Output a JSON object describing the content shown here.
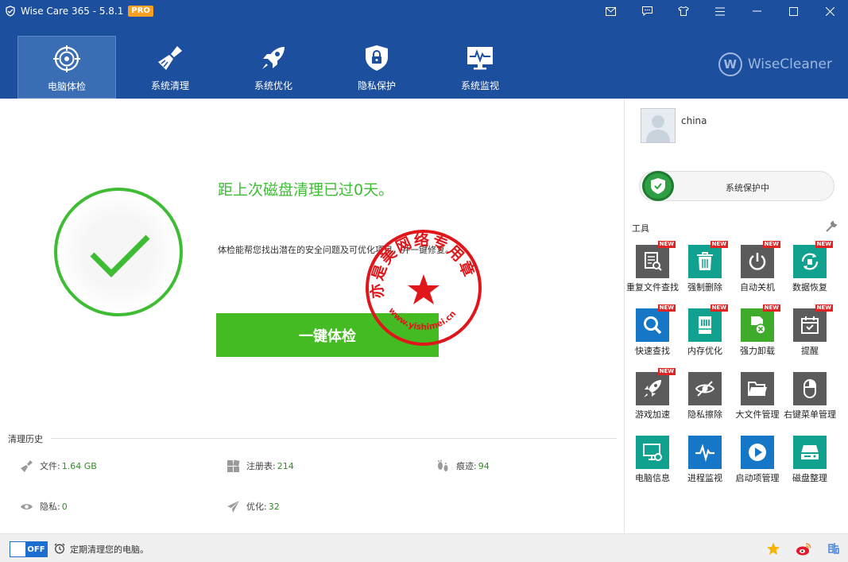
{
  "app": {
    "title": "Wise Care 365 - 5.8.1",
    "badge": "PRO",
    "brand": "WiseCleaner"
  },
  "nav": [
    {
      "label": "电脑体检",
      "icon": "target-icon"
    },
    {
      "label": "系统清理",
      "icon": "broom-icon"
    },
    {
      "label": "系统优化",
      "icon": "rocket-icon"
    },
    {
      "label": "隐私保护",
      "icon": "lock-shield-icon"
    },
    {
      "label": "系统监视",
      "icon": "monitor-icon"
    }
  ],
  "main": {
    "headline": "距上次磁盘清理已过0天。",
    "description": "体检能帮您找出潜在的安全问题及可优化项目，并一键修复。",
    "scan_button": "一键体检",
    "stamp_text": "亦是美网络专用章",
    "stamp_url": "www.yishimei.cn"
  },
  "history": {
    "title": "清理历史",
    "items": [
      {
        "label": "文件:",
        "value": "1.64 GB"
      },
      {
        "label": "注册表:",
        "value": "214"
      },
      {
        "label": "痕迹:",
        "value": "94"
      },
      {
        "label": "隐私:",
        "value": "0"
      },
      {
        "label": "优化:",
        "value": "32"
      }
    ]
  },
  "side": {
    "username": "china",
    "protection": "系统保护中",
    "tools_title": "工具",
    "new_badge": "NEW",
    "tools": [
      {
        "label": "重复文件查找",
        "color": "#5b5b5b",
        "icon": "duplicate-file-icon",
        "new": true
      },
      {
        "label": "强制删除",
        "color": "#11a28f",
        "icon": "trash-icon",
        "new": true
      },
      {
        "label": "自动关机",
        "color": "#5b5b5b",
        "icon": "power-icon",
        "new": true
      },
      {
        "label": "数据恢复",
        "color": "#11a28f",
        "icon": "recover-icon",
        "new": true
      },
      {
        "label": "快速查找",
        "color": "#1677c6",
        "icon": "search-icon",
        "new": true
      },
      {
        "label": "内存优化",
        "color": "#11a28f",
        "icon": "memory-icon",
        "new": true
      },
      {
        "label": "强力卸载",
        "color": "#3eab2a",
        "icon": "uninstall-icon",
        "new": true
      },
      {
        "label": "提醒",
        "color": "#5b5b5b",
        "icon": "calendar-icon",
        "new": true
      },
      {
        "label": "游戏加速",
        "color": "#5b5b5b",
        "icon": "rocket-icon",
        "new": true
      },
      {
        "label": "隐私擦除",
        "color": "#5b5b5b",
        "icon": "eye-off-icon",
        "new": false
      },
      {
        "label": "大文件管理",
        "color": "#5b5b5b",
        "icon": "folder-icon",
        "new": false
      },
      {
        "label": "右键菜单管理",
        "color": "#5b5b5b",
        "icon": "mouse-icon",
        "new": false
      },
      {
        "label": "电脑信息",
        "color": "#11a28f",
        "icon": "pc-info-icon",
        "new": false
      },
      {
        "label": "进程监视",
        "color": "#1677c6",
        "icon": "pulse-icon",
        "new": false
      },
      {
        "label": "启动项管理",
        "color": "#1677c6",
        "icon": "play-icon",
        "new": false
      },
      {
        "label": "磁盘整理",
        "color": "#11a28f",
        "icon": "disk-icon",
        "new": false
      }
    ]
  },
  "footer": {
    "toggle": "OFF",
    "text": "定期清理您的电脑。"
  }
}
